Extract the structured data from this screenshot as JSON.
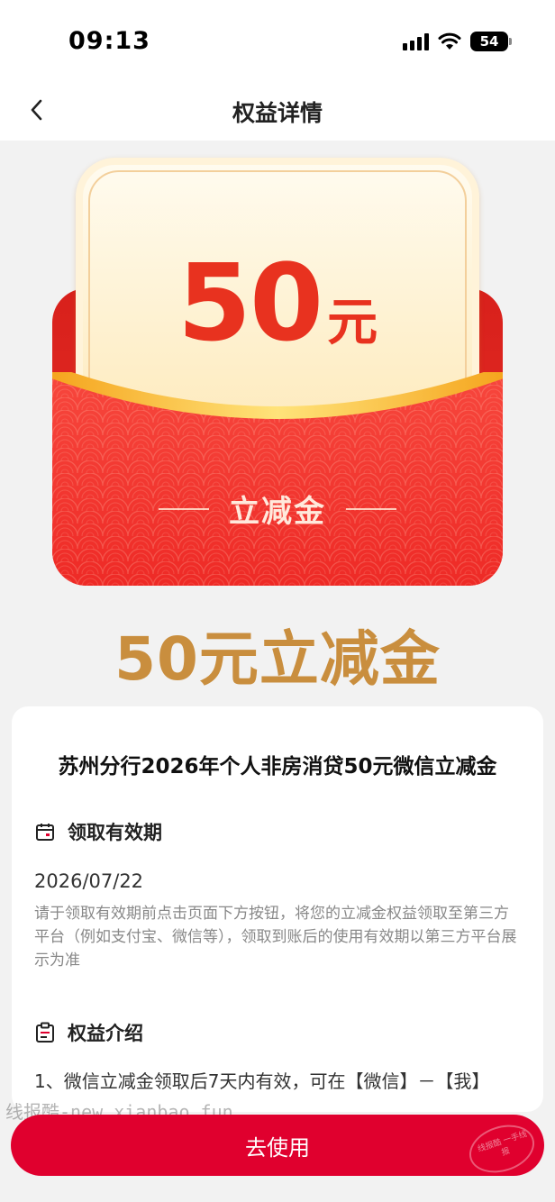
{
  "status_bar": {
    "time": "09:13",
    "battery": "54"
  },
  "nav": {
    "title": "权益详情"
  },
  "envelope": {
    "amount": "50",
    "unit": "元",
    "label": "立减金"
  },
  "headline": "50元立减金",
  "detail": {
    "title": "苏州分行2026年个人非房消贷50元微信立减金",
    "validity_label": "领取有效期",
    "validity_date": "2026/07/22",
    "validity_desc": "请于领取有效期前点击页面下方按钮，将您的立减金权益领取至第三方平台（例如支付宝、微信等），领取到账后的使用有效期以第三方平台展示为准",
    "benefit_label": "权益介绍",
    "benefit_line_1": "1、微信立减金领取后7天内有效，可在【微信】－【我】"
  },
  "watermark": "线报酷-new.xianbao.fun",
  "stamp_text": "线报酷 一手线报",
  "action": {
    "button_label": "去使用"
  },
  "colors": {
    "primary": "#e0002e",
    "gold": "#c98e3e",
    "amount_red": "#e8321f"
  }
}
